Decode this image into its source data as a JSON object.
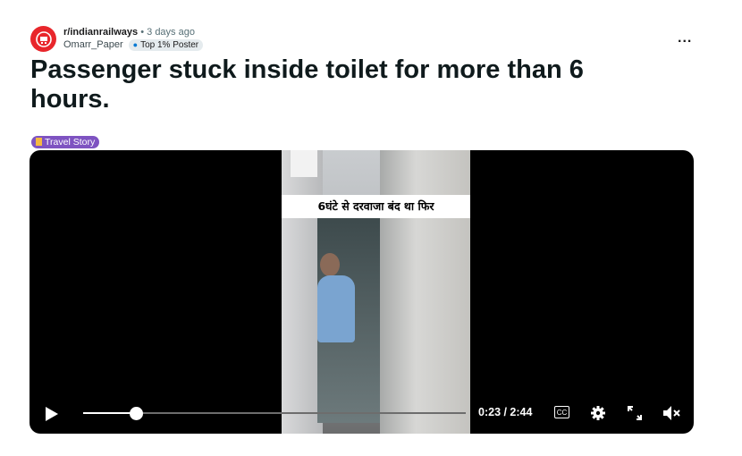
{
  "post": {
    "subreddit": "r/indianrailways",
    "separator": "•",
    "age": "3 days ago",
    "author": "Omarr_Paper",
    "author_flair": "Top 1% Poster",
    "more_label": "...",
    "title": "Passenger stuck inside toilet for more than 6 hours.",
    "post_flair": "Travel Story"
  },
  "video": {
    "caption": "6घंटे से दरवाजा बंद था फिर",
    "current_time": "0:23",
    "total_time": "2:44",
    "time_display": "0:23 / 2:44",
    "progress_fraction": 0.14,
    "cc_label": "CC",
    "muted": true,
    "icons": {
      "play": "play-icon",
      "settings": "gear-icon",
      "fullscreen": "expand-icon",
      "volume": "volume-muted-icon"
    }
  },
  "colors": {
    "subreddit_avatar": "#e8262b",
    "post_flair_bg": "#7e53c1",
    "video_bg": "#000000"
  }
}
